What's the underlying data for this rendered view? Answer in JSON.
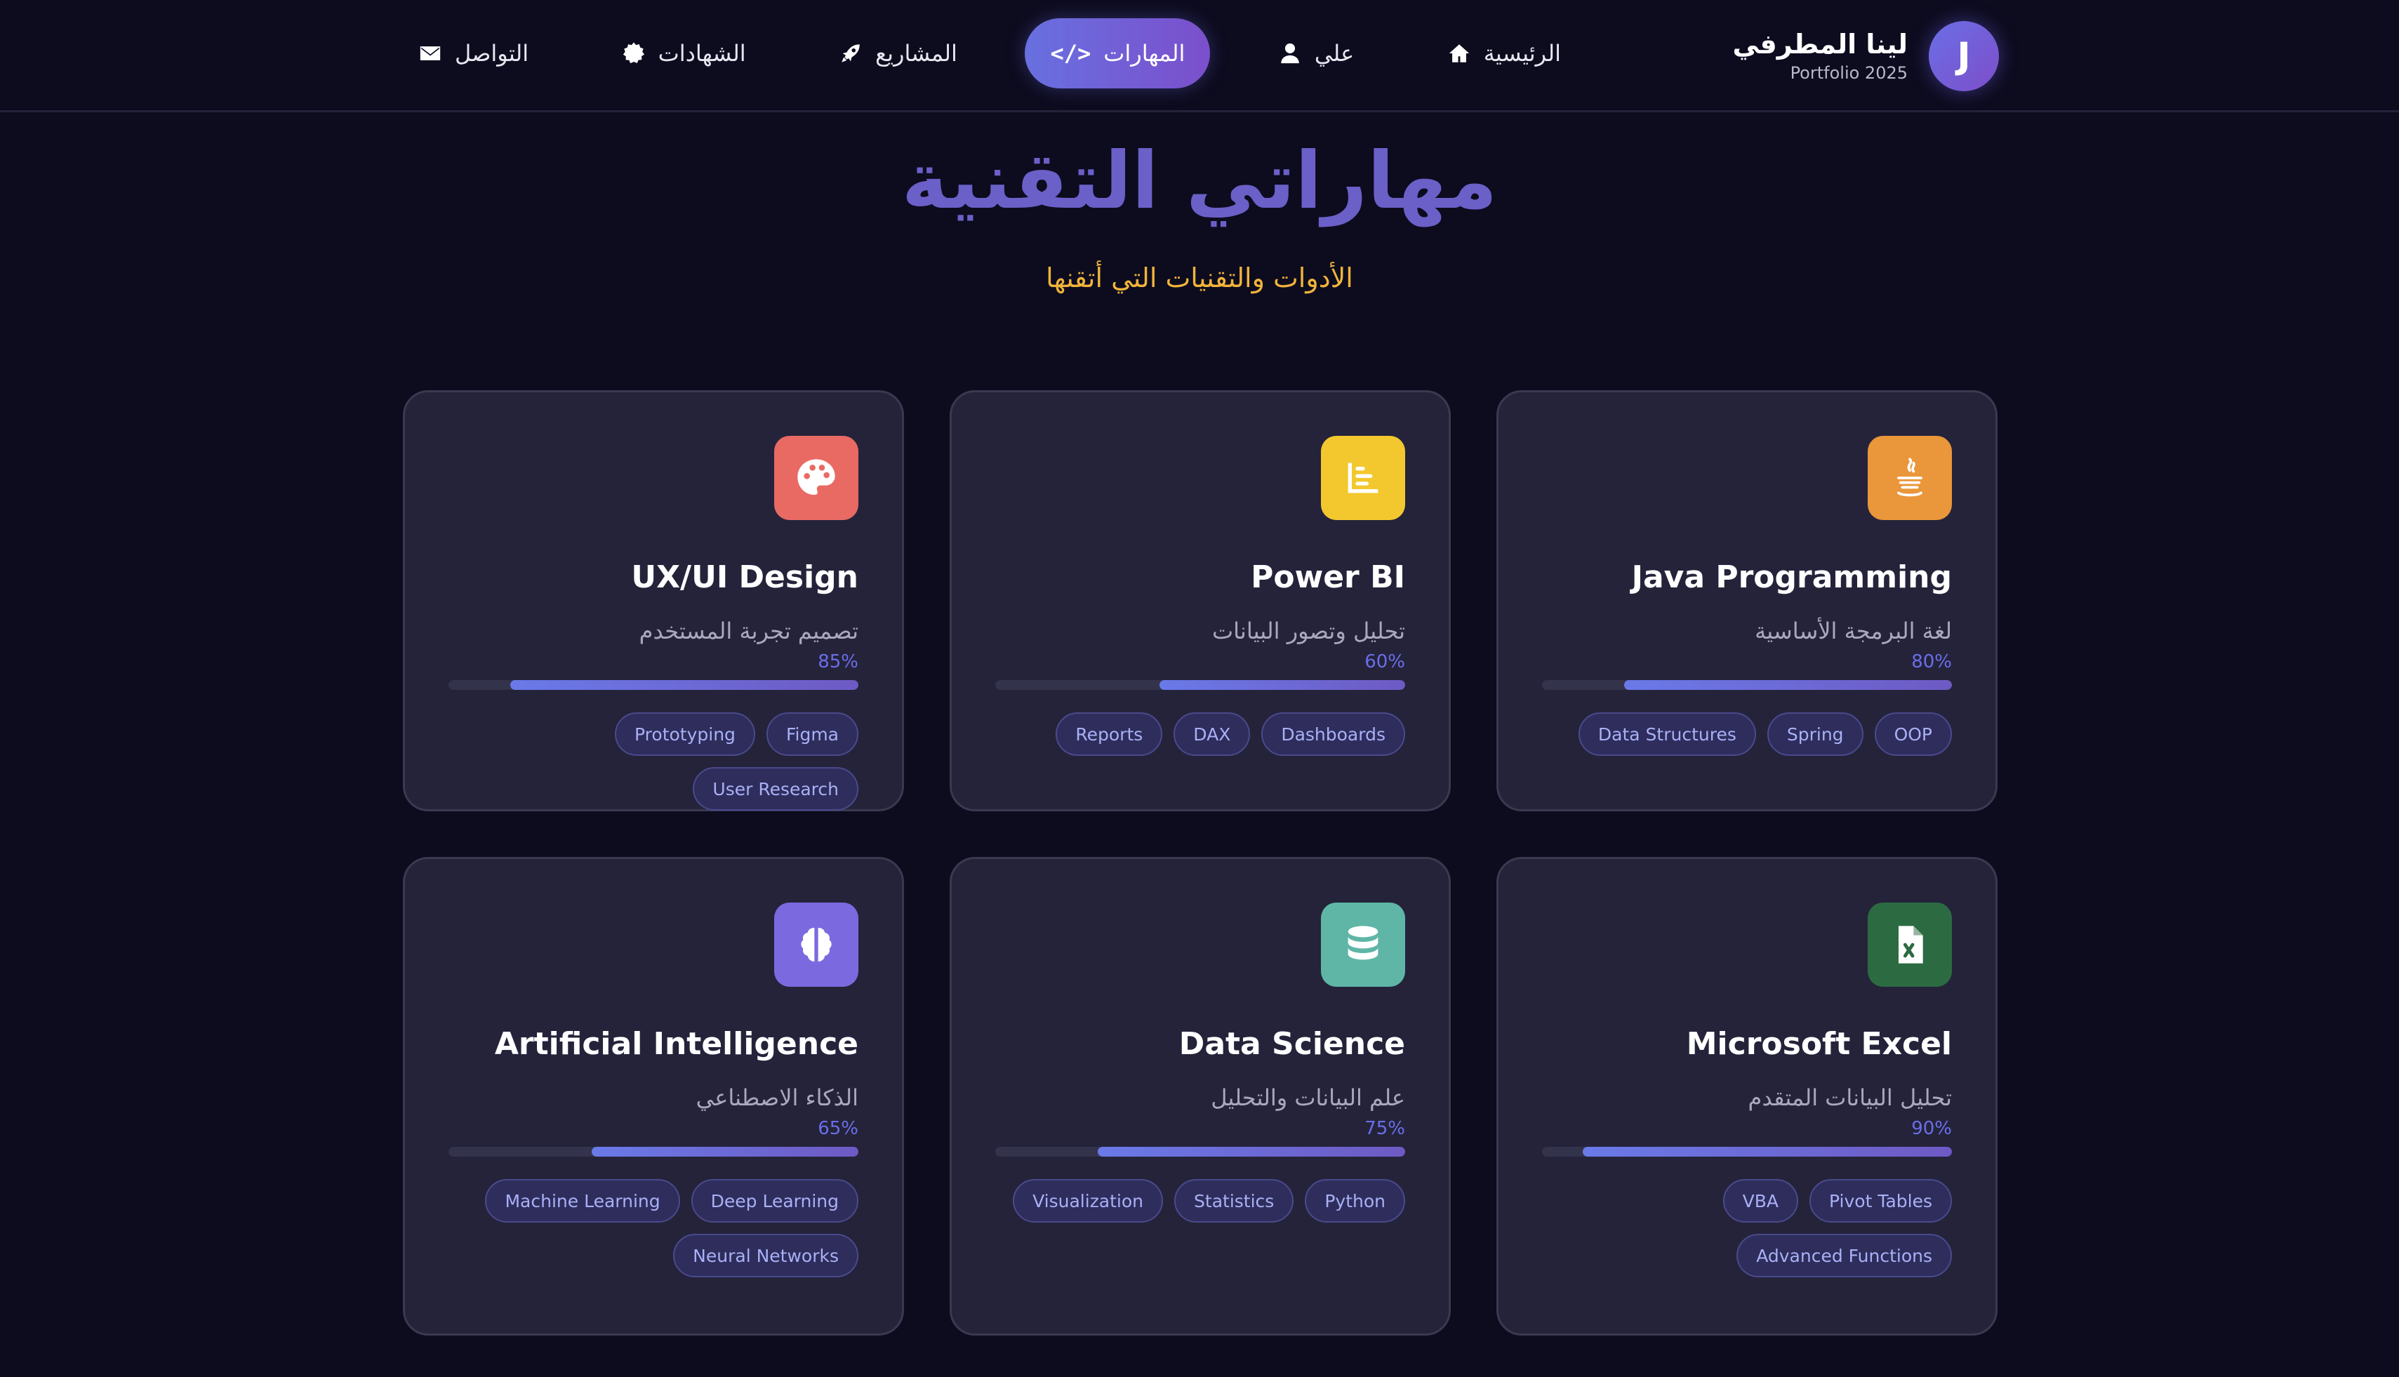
{
  "brand": {
    "initial": "J",
    "name": "لينا المطرفي",
    "subtitle": "Portfolio 2025"
  },
  "nav": {
    "items": [
      {
        "label": "الرئيسية",
        "icon": "home-icon"
      },
      {
        "label": "علي",
        "icon": "user-icon"
      },
      {
        "label": "المهارات",
        "icon": "code-icon",
        "active": true
      },
      {
        "label": "المشاريع",
        "icon": "rocket-icon"
      },
      {
        "label": "الشهادات",
        "icon": "certificate-icon"
      },
      {
        "label": "التواصل",
        "icon": "envelope-icon"
      }
    ]
  },
  "section": {
    "title": "مهاراتي التقنية",
    "subtitle": "الأدوات والتقنيات التي أتقنها"
  },
  "cards": [
    {
      "title": "Java Programming",
      "desc": "لغة البرمجة الأساسية",
      "percent_label": "80%",
      "percent": 80,
      "icon": "java-icon",
      "icon_color": "#ea963a",
      "tags": [
        "OOP",
        "Spring",
        "Data Structures"
      ]
    },
    {
      "title": "Power BI",
      "desc": "تحليل وتصور البيانات",
      "percent_label": "60%",
      "percent": 60,
      "icon": "chart-icon",
      "icon_color": "#f3c82f",
      "tags": [
        "Dashboards",
        "DAX",
        "Reports"
      ]
    },
    {
      "title": "UX/UI Design",
      "desc": "تصميم تجربة المستخدم",
      "percent_label": "85%",
      "percent": 85,
      "icon": "palette-icon",
      "icon_color": "#e96a63",
      "tags": [
        "Figma",
        "Prototyping",
        "User Research"
      ]
    },
    {
      "title": "Microsoft Excel",
      "desc": "تحليل البيانات المتقدم",
      "percent_label": "90%",
      "percent": 90,
      "icon": "excel-file-icon",
      "icon_color": "#2c6b42",
      "tags": [
        "Pivot Tables",
        "VBA",
        "Advanced Functions"
      ]
    },
    {
      "title": "Data Science",
      "desc": "علم البيانات والتحليل",
      "percent_label": "75%",
      "percent": 75,
      "icon": "database-icon",
      "icon_color": "#5fb6a6",
      "tags": [
        "Python",
        "Statistics",
        "Visualization"
      ]
    },
    {
      "title": "Artificial Intelligence",
      "desc": "الذكاء الاصطناعي",
      "percent_label": "65%",
      "percent": 65,
      "icon": "brain-icon",
      "icon_color": "#7b6adf",
      "tags": [
        "Deep Learning",
        "Machine Learning",
        "Neural Networks"
      ]
    }
  ]
}
